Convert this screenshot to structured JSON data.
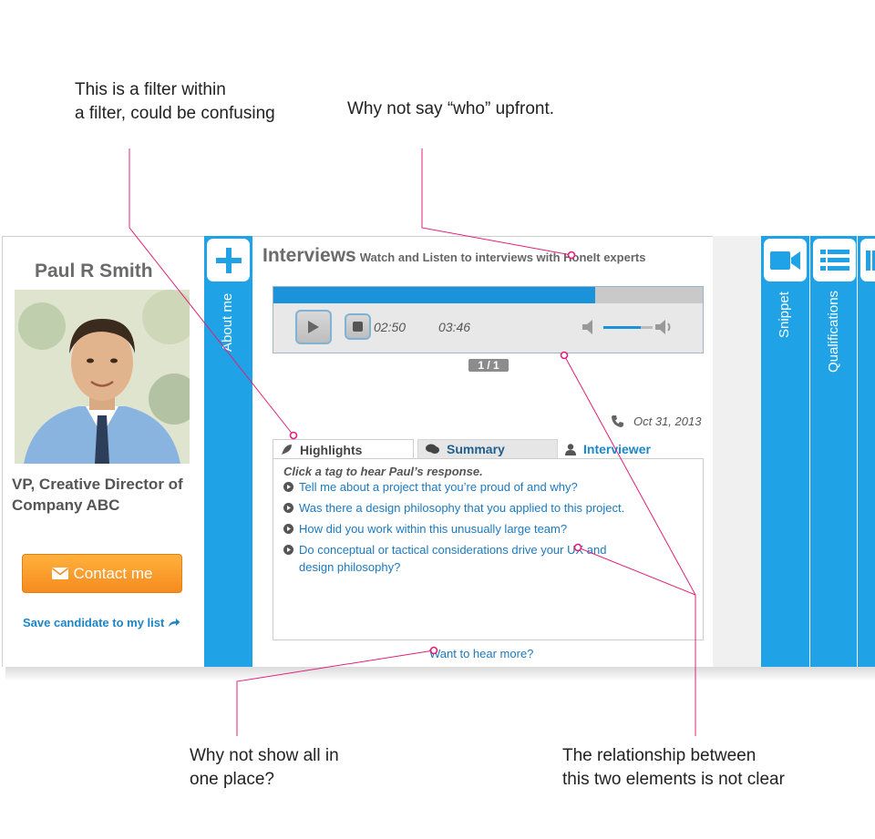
{
  "annotations": {
    "filter_note": [
      "This is a filter within",
      "a filter, could be confusing"
    ],
    "who_note": "Why not say “who” upfront.",
    "show_all_note": [
      "Why not show all in",
      "one place?"
    ],
    "relationship_note": [
      "The relationship between",
      "this two elements is not clear"
    ]
  },
  "colors": {
    "brand_blue": "#1fa2e6",
    "accent_orange": "#f68b1e",
    "link_blue": "#1c79bf",
    "annotation_pink": "#e0207a"
  },
  "profile": {
    "name": "Paul R Smith",
    "title": "VP, Creative Director of Company ABC",
    "contact_label": "Contact me",
    "save_label": "Save candidate to my list"
  },
  "side_tabs": {
    "about": {
      "label": "About me",
      "icon": "plus-icon"
    },
    "snippet": {
      "label": "Snippet",
      "icon": "video-camera-icon"
    },
    "qualifications": {
      "label": "Qualifications",
      "icon": "list-icon"
    }
  },
  "interviews": {
    "heading": "Interviews",
    "subheading": "Watch and Listen to interviews with HoneIt experts",
    "player": {
      "elapsed": "02:50",
      "duration": "03:46",
      "progress_fraction": 0.75,
      "volume_fraction": 0.75
    },
    "pager": "1 / 1",
    "date": "Oct 31, 2013",
    "tabs": {
      "highlights": "Highlights",
      "summary": "Summary",
      "interviewer": "Interviewer"
    },
    "hint": "Click a tag to hear Paul’s response.",
    "questions": [
      "Tell me about a project that you’re proud of and why?",
      "Was there a design philosophy that you applied to this project.",
      "How did you work within this unusually large team?",
      "Do conceptual or tactical considerations drive your UX and design philosophy?"
    ],
    "more_link": "Want to hear more?"
  }
}
